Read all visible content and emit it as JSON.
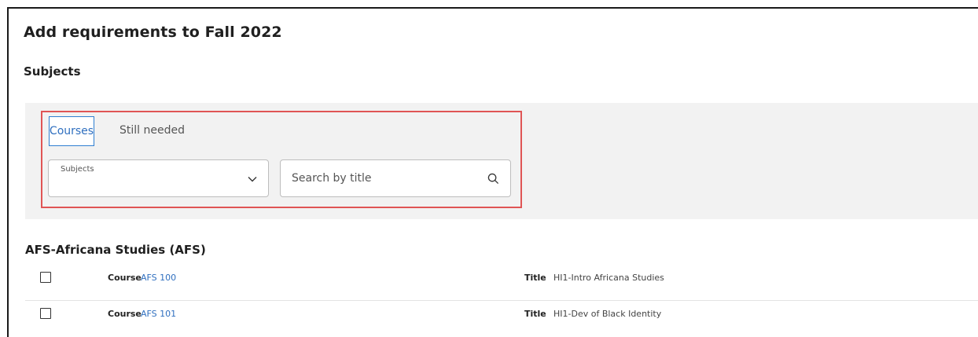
{
  "page": {
    "title": "Add requirements to Fall 2022",
    "section_title": "Subjects"
  },
  "filters": {
    "tabs": [
      {
        "label": "Courses",
        "active": true
      },
      {
        "label": "Still needed",
        "active": false
      }
    ],
    "subjects_select": {
      "label": "Subjects",
      "value": ""
    },
    "search": {
      "placeholder": "Search by title",
      "value": ""
    }
  },
  "colors": {
    "accent": "#2f6fbf",
    "highlight_border": "#e05555",
    "panel_bg": "#f2f2f2"
  },
  "results": {
    "group_title": "AFS-Africana Studies (AFS)",
    "course_field_label": "Course",
    "title_field_label": "Title",
    "rows": [
      {
        "course": "AFS 100",
        "title": "HI1-Intro Africana Studies",
        "checked": false
      },
      {
        "course": "AFS 101",
        "title": "HI1-Dev of Black Identity",
        "checked": false
      }
    ]
  }
}
